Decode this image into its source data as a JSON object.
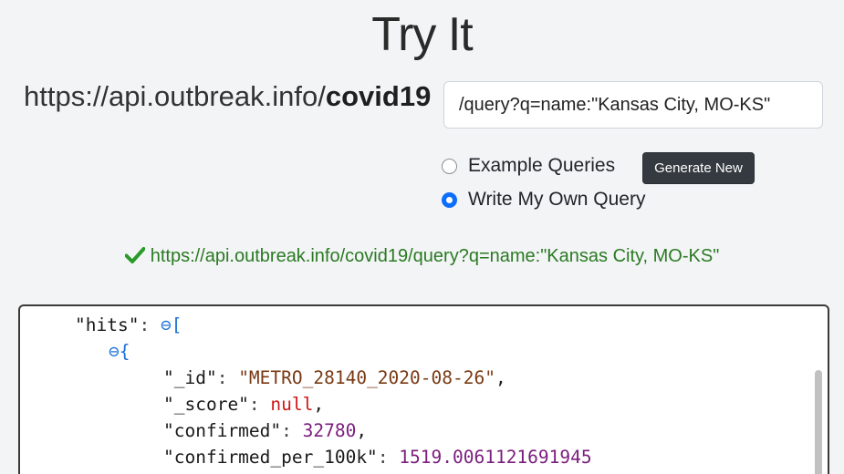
{
  "header": {
    "title": "Try It"
  },
  "endpoint": {
    "base_host": "https://api.outbreak.info/",
    "base_path": "covid19"
  },
  "query": {
    "value": "/query?q=name:\"Kansas City, MO-KS\""
  },
  "modes": {
    "example_label": "Example Queries",
    "own_label": "Write My Own Query",
    "selected": "Write My Own Query",
    "generate_label": "Generate New"
  },
  "validation": {
    "url": "https://api.outbreak.info/covid19/query?q=name:\"Kansas City, MO-KS\"",
    "status_color": "#2a7a22"
  },
  "json_view": {
    "hits_key": "\"hits\"",
    "colon": ": ",
    "collapse_glyph": "⊖",
    "open_bracket": "[",
    "open_brace": "{",
    "comma": ",",
    "fields": [
      {
        "key": "\"_id\"",
        "value": "\"METRO_28140_2020-08-26\"",
        "type": "string"
      },
      {
        "key": "\"_score\"",
        "value": "null",
        "type": "null"
      },
      {
        "key": "\"confirmed\"",
        "value": "32780",
        "type": "number"
      },
      {
        "key": "\"confirmed_per_100k\"",
        "value": "1519.0061121691945",
        "type": "number"
      }
    ]
  },
  "colors": {
    "accent": "#0d6efd",
    "button_dark": "#343a40",
    "string": "#7a3a14",
    "null": "#d11515",
    "number": "#7a1e7d",
    "collapse": "#1a6fd6"
  }
}
